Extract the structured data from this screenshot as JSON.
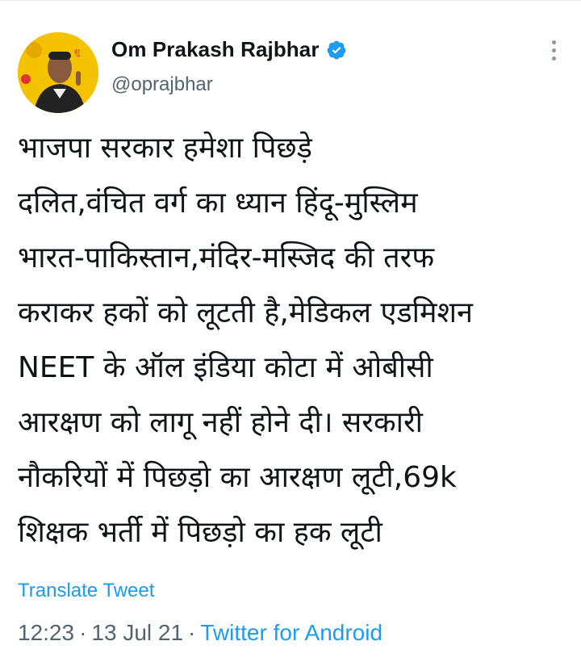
{
  "colors": {
    "text": "#0f1419",
    "secondary": "#536471",
    "link": "#1d9bf0",
    "verified": "#1d9bf0",
    "avatar_bg": "#f3c400"
  },
  "author": {
    "display_name": "Om Prakash Rajbhar",
    "handle": "@oprajbhar",
    "verified": true
  },
  "tweet": {
    "lines": [
      "भाजपा सरकार हमेशा पिछड़े",
      "दलित,वंचित वर्ग का ध्यान हिंदू-मुस्लिम",
      "भारत-पाकिस्तान,मंदिर-मस्जिद की तरफ",
      "कराकर हकों को लूटती है,मेडिकल एडमिशन",
      "NEET के ऑल इंडिया कोटा में ओबीसी",
      "आरक्षण को लागू नहीं होने दी। सरकारी",
      "नौकरियों में पिछड़ो का आरक्षण लूटी,69k",
      "शिक्षक भर्ती में पिछड़ो का हक लूटी"
    ],
    "translate_label": "Translate Tweet",
    "time": "12:23",
    "date": "13 Jul 21",
    "source": "Twitter for Android",
    "separator": "·"
  },
  "icons": {
    "verified": "verified-badge-icon",
    "more": "more-options-icon"
  }
}
